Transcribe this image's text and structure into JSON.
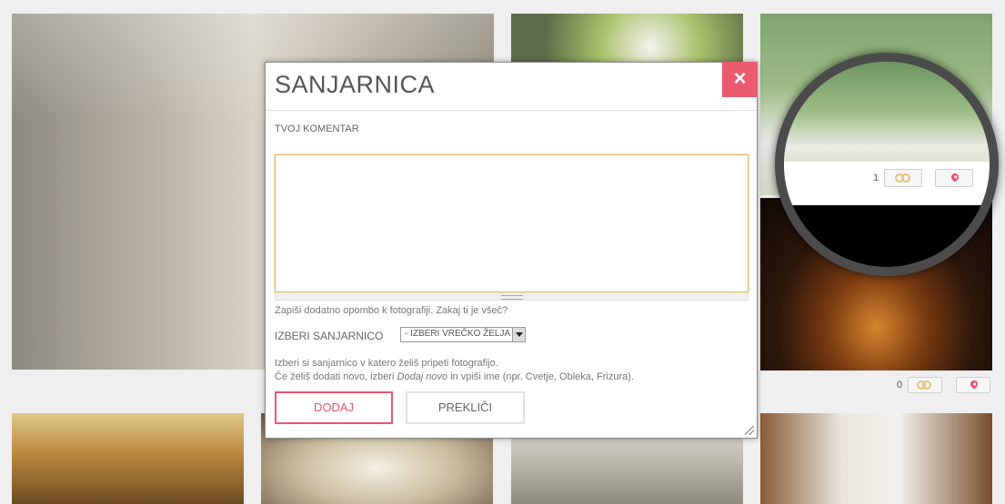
{
  "modal": {
    "title": "SANJARNICA",
    "close_symbol": "×",
    "comment_label": "TVOJ KOMENTAR",
    "comment_value": "",
    "comment_hint": "Zapiši dodatno opombo k fotografiji. Zakaj ti je všeč?",
    "select_label": "IZBERI SANJARNICO",
    "select_value": "- IZBERI VREČKO ŽELJA -",
    "help_line1": "Izberi si sanjarnico v katero želiš pripeti fotografijo.",
    "help_line2_pre": "Če želiš dodati novo, izberi ",
    "help_line2_em": "Dodaj novo",
    "help_line2_post": " in vpiši ime (npr. Cvetje, Obleka, Frizura).",
    "add_label": "DODAJ",
    "cancel_label": "PREKLIČI",
    "accent_color": "#e8576e"
  },
  "gallery": {
    "tile4": {
      "like_count": "0"
    },
    "magnifier": {
      "like_count": "1"
    }
  }
}
